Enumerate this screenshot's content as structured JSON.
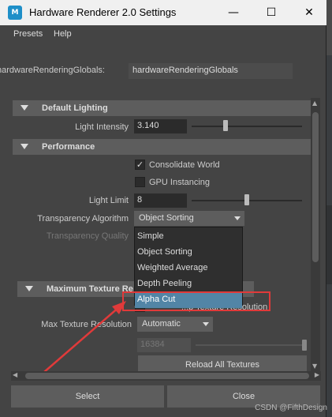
{
  "window": {
    "title": "Hardware Renderer 2.0 Settings",
    "app_icon_text": "M",
    "minimize_glyph": "—",
    "maximize_glyph": "☐",
    "close_glyph": "✕"
  },
  "menu": {
    "items": [
      "Presets",
      "Help"
    ]
  },
  "globals": {
    "label": "hardwareRenderingGlobals:",
    "value": "hardwareRenderingGlobals"
  },
  "default_lighting": {
    "header": "Default Lighting",
    "light_intensity_label": "Light Intensity",
    "light_intensity_value": "3.140",
    "light_intensity_slider_fraction": 0.31
  },
  "performance": {
    "header": "Performance",
    "consolidate_world_label": "Consolidate World",
    "consolidate_world_checked": true,
    "consolidate_check_glyph": "✓",
    "gpu_instancing_label": "GPU Instancing",
    "gpu_instancing_checked": false,
    "light_limit_label": "Light Limit",
    "light_limit_value": "8",
    "light_limit_slider_fraction": 0.5,
    "transparency_algorithm_label": "Transparency Algorithm",
    "transparency_algorithm_value": "Object Sorting",
    "transparency_quality_label": "Transparency Quality"
  },
  "transparency_dropdown": {
    "options": [
      "Simple",
      "Object Sorting",
      "Weighted Average",
      "Depth Peeling",
      "Alpha Cut"
    ],
    "highlighted": "Alpha Cut"
  },
  "max_texture": {
    "header": "Maximum Texture Re",
    "partial_hidden_text": "...p Texture Resolution",
    "max_texture_resolution_label": "Max Texture Resolution",
    "max_texture_resolution_value": "Automatic",
    "resolution_field_value": "16384",
    "reload_button_label": "Reload All Textures"
  },
  "buttons": {
    "select_label": "Select",
    "close_label": "Close"
  },
  "watermark": "CSDN @FifthDesign",
  "colors": {
    "panel_bg": "#444444",
    "selection": "#5285a6",
    "annotation_red": "#e03a3a"
  }
}
